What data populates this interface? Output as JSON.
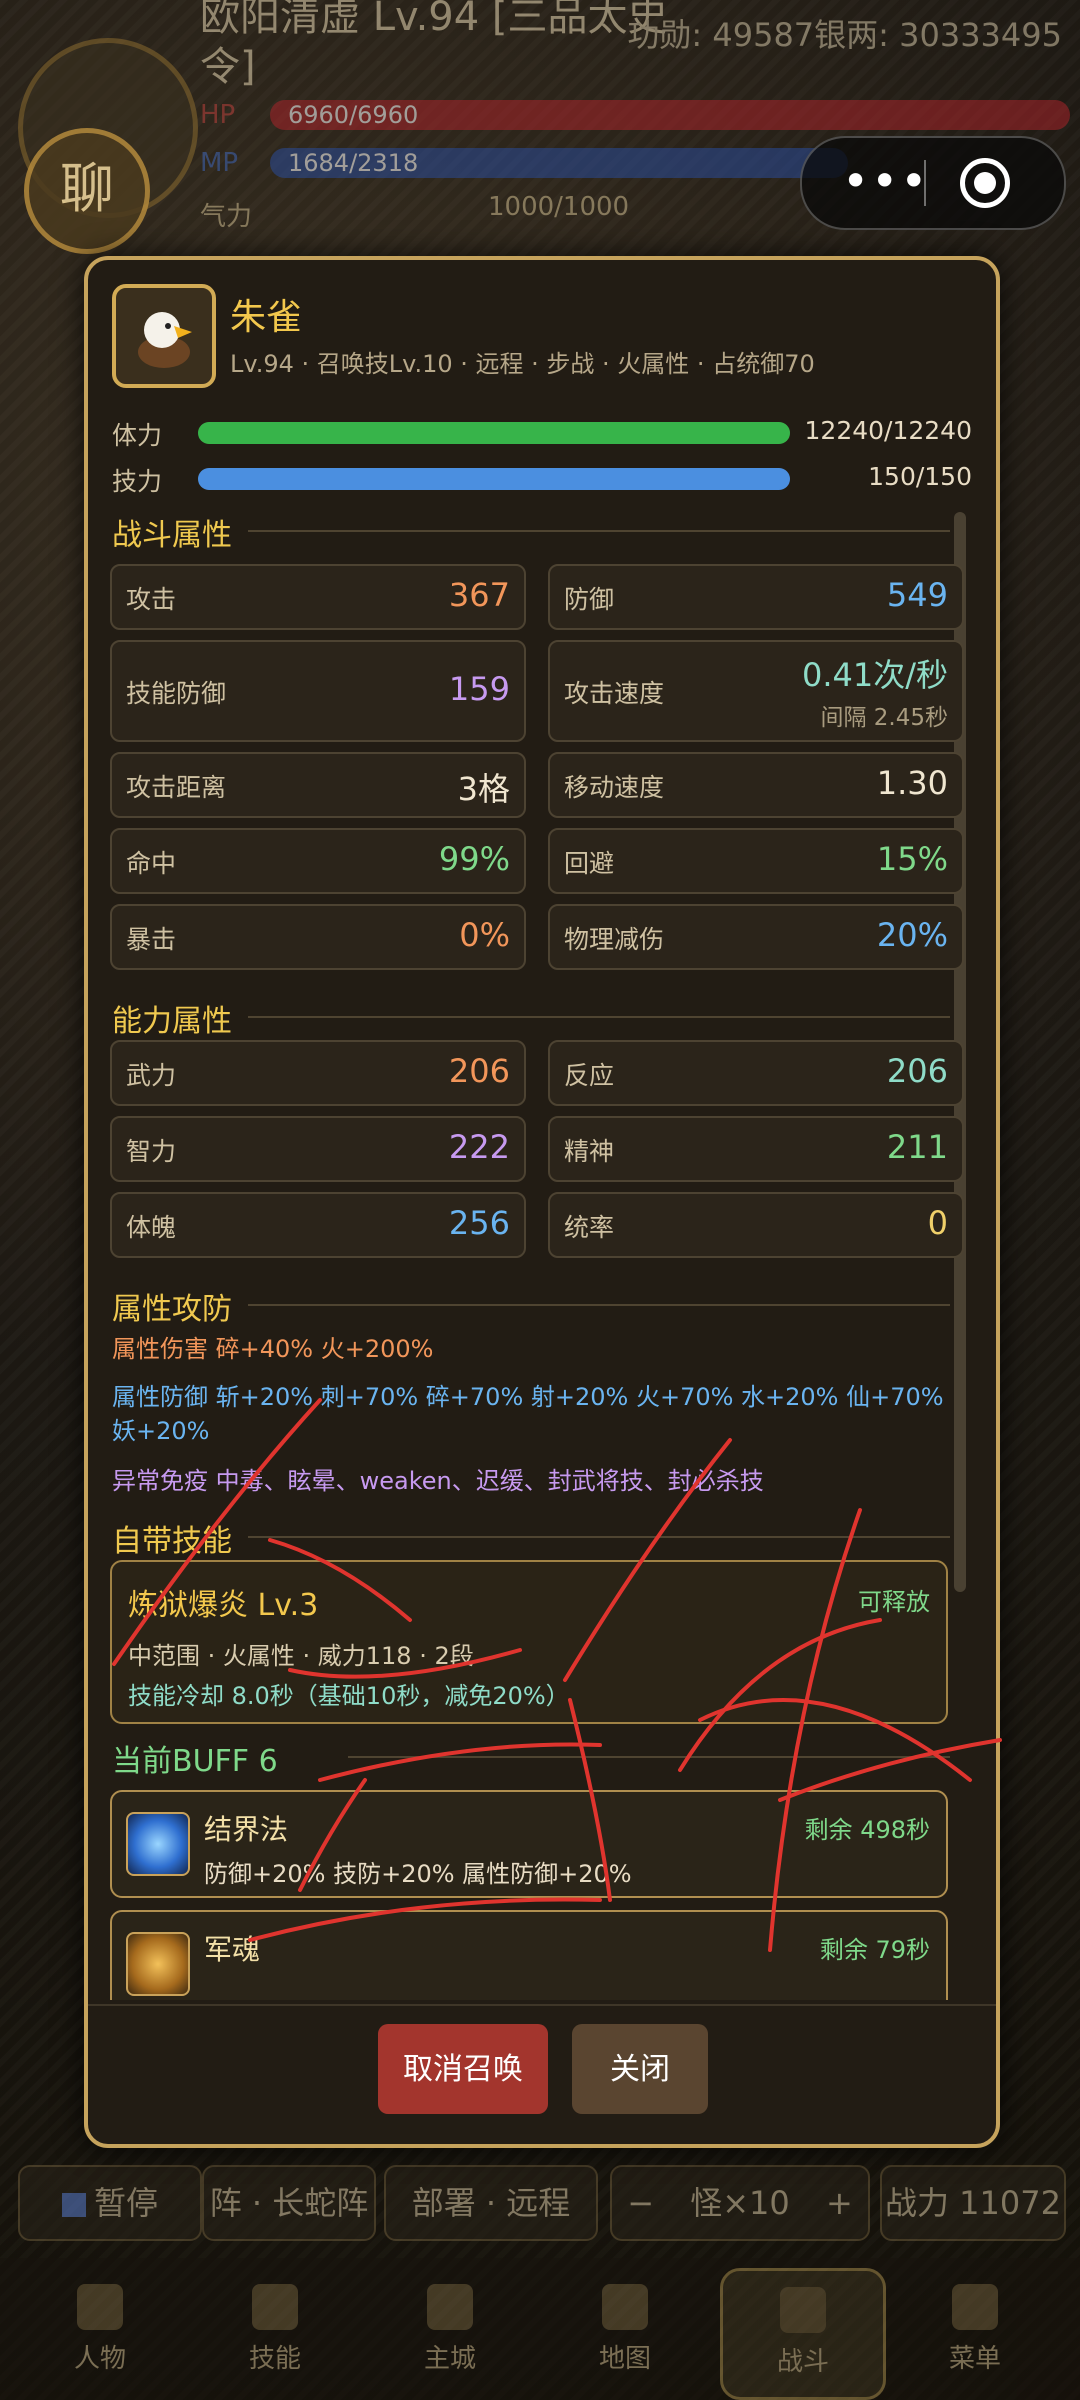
{
  "hud": {
    "player_name": "欧阳清虚 Lv.94 [三品太史令]",
    "merit": "功勋: 49587银两: 30333495",
    "hp_label": "HP",
    "hp_value": "6960/6960",
    "mp_label": "MP",
    "mp_value": "1684/2318",
    "qi_label": "气力",
    "qi_value": "1000/1000",
    "chat_label": "聊"
  },
  "modal": {
    "name": "朱雀",
    "subtitle": "Lv.94 · 召唤技Lv.10 · 远程 · 步战 · 火属性 · 占统御70",
    "stamina_label": "体力",
    "stamina_value": "12240/12240",
    "stamina_fraction": 1.0,
    "skillpower_label": "技力",
    "skillpower_value": "150/150",
    "skillpower_fraction": 1.0,
    "combat_title": "战斗属性",
    "combat": [
      {
        "k": "攻击",
        "v": "367",
        "color": "#f2965a"
      },
      {
        "k": "防御",
        "v": "549",
        "color": "#6ab4f0"
      },
      {
        "k": "技能防御",
        "v": "159",
        "color": "#c79af0"
      },
      {
        "k": "攻击速度",
        "v": "0.41次/秒",
        "sub": "间隔 2.45秒",
        "color": "#8fdcc8"
      },
      {
        "k": "攻击距离",
        "v": "3格",
        "color": "#f0e6d0"
      },
      {
        "k": "移动速度",
        "v": "1.30",
        "color": "#f0e6d0"
      },
      {
        "k": "命中",
        "v": "99%",
        "color": "#7fd98a"
      },
      {
        "k": "回避",
        "v": "15%",
        "color": "#7fd98a"
      },
      {
        "k": "暴击",
        "v": "0%",
        "color": "#f2965a"
      },
      {
        "k": "物理减伤",
        "v": "20%",
        "color": "#6ab4f0"
      }
    ],
    "ability_title": "能力属性",
    "ability": [
      {
        "k": "武力",
        "v": "206",
        "color": "#f2965a"
      },
      {
        "k": "反应",
        "v": "206",
        "color": "#8fdcc8"
      },
      {
        "k": "智力",
        "v": "222",
        "color": "#c79af0"
      },
      {
        "k": "精神",
        "v": "211",
        "color": "#7fd98a"
      },
      {
        "k": "体魄",
        "v": "256",
        "color": "#6ab4f0"
      },
      {
        "k": "统率",
        "v": "0",
        "color": "#f0d06a"
      }
    ],
    "elem_title": "属性攻防",
    "elem_damage": "属性伤害  碎+40%  火+200%",
    "elem_defense": "属性防御  斩+20%  刺+70%  碎+70%  射+20%  火+70%  水+20%  仙+70%  妖+20%",
    "immunity": "异常免疫  中毒、眩晕、weaken、迟缓、封武将技、封必杀技",
    "skill_title": "自带技能",
    "skill": {
      "name": "炼狱爆炎  Lv.3",
      "status": "可释放",
      "desc": "中范围 · 火属性 · 威力118 · 2段",
      "cooldown": "技能冷却 8.0秒（基础10秒，减免20%）"
    },
    "buff_title": "当前BUFF  6",
    "buffs": [
      {
        "name": "结界法",
        "remain": "剩余 498秒",
        "effect": "防御+20%  技防+20%  属性防御+20%"
      },
      {
        "name": "军魂",
        "remain": "剩余 79秒",
        "effect": ""
      }
    ],
    "btn_cancel": "取消召唤",
    "btn_close": "关闭"
  },
  "bottom": {
    "pause": "暂停",
    "formation": "阵 · 长蛇阵",
    "deploy": "部署 · 远程",
    "minus": "−",
    "monster": "怪×10",
    "plus": "+",
    "power": "战力 11072",
    "nav": [
      "人物",
      "技能",
      "主城",
      "地图",
      "战斗",
      "菜单"
    ]
  },
  "colors": {
    "gold": "#c6a35c",
    "cancel_btn": "#a3352d",
    "close_btn": "#5a4530",
    "stamina": "#37b44a",
    "skillpower": "#4b8fe0",
    "scribble": "#e0342e"
  }
}
